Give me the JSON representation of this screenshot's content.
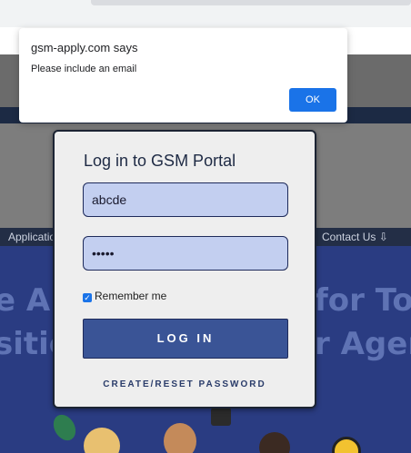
{
  "alert": {
    "title": "gsm-apply.com says",
    "message": "Please include an email",
    "ok_label": "OK"
  },
  "nav": {
    "left_item": "Applicatio",
    "right_item": "Contact Us ⇩"
  },
  "hero": {
    "line1_left": "e Ap",
    "line1_right": "for Top",
    "line2_left": "sitie",
    "line2_right": "r Agen"
  },
  "login": {
    "title": "Log in to GSM Portal",
    "username_value": "abcde",
    "password_value": "•••••",
    "remember_label": "Remember me",
    "remember_checked": true,
    "login_label": "LOG IN",
    "reset_label": "CREATE/RESET PASSWORD"
  },
  "colors": {
    "accent": "#1a73e8",
    "button": "#3a5496",
    "field_bg": "#c3cff0",
    "hero_bg": "#2a3c82"
  }
}
